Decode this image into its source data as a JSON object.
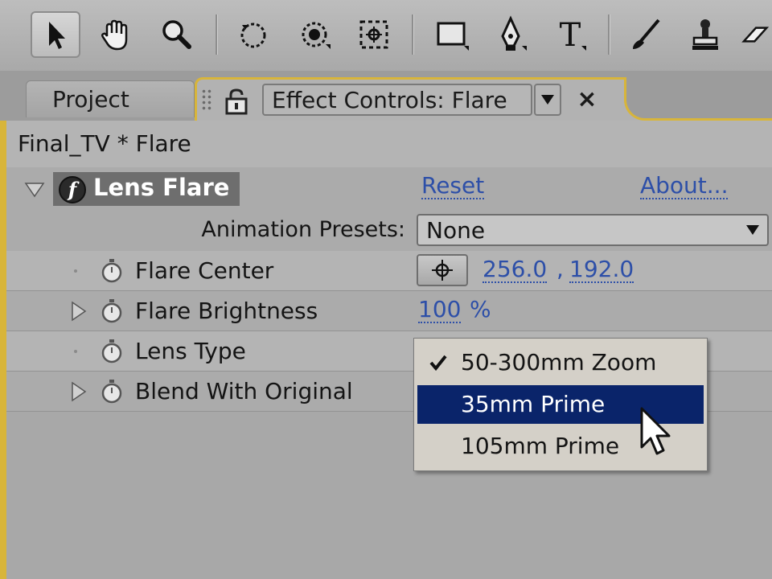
{
  "toolbar": {
    "tools": [
      {
        "name": "selection-tool",
        "icon": "arrow-pointer-icon",
        "active": true
      },
      {
        "name": "hand-tool",
        "icon": "hand-icon",
        "active": false
      },
      {
        "name": "zoom-tool",
        "icon": "magnifier-icon",
        "active": false
      },
      {
        "name": "rotate-tool",
        "icon": "rotate-icon",
        "active": false
      },
      {
        "name": "camera-tool",
        "icon": "orbit-camera-icon",
        "active": false
      },
      {
        "name": "pan-behind-tool",
        "icon": "pan-behind-icon",
        "active": false
      },
      {
        "name": "rectangle-tool",
        "icon": "rectangle-icon",
        "active": false
      },
      {
        "name": "pen-tool",
        "icon": "pen-icon",
        "active": false
      },
      {
        "name": "type-tool",
        "icon": "type-icon",
        "active": false
      },
      {
        "name": "brush-tool",
        "icon": "brush-icon",
        "active": false
      },
      {
        "name": "clone-stamp-tool",
        "icon": "stamp-icon",
        "active": false
      },
      {
        "name": "eraser-tool",
        "icon": "eraser-icon",
        "active": false
      }
    ]
  },
  "tabs": {
    "project_label": "Project",
    "effect_controls_label": "Effect Controls: Flare",
    "close_glyph": "×"
  },
  "panel": {
    "path": "Final_TV * Flare",
    "effect": {
      "name": "Lens Flare",
      "reset_label": "Reset",
      "about_label": "About...",
      "presets_label": "Animation Presets:",
      "presets_value": "None"
    },
    "properties": [
      {
        "label": "Flare Center",
        "value_x": "256.0",
        "value_sep": ",",
        "value_y": "192.0"
      },
      {
        "label": "Flare Brightness",
        "value": "100",
        "unit": "%"
      },
      {
        "label": "Lens Type"
      },
      {
        "label": "Blend With Original"
      }
    ]
  },
  "menu": {
    "items": [
      {
        "label": "50-300mm Zoom",
        "checked": true,
        "highlighted": false
      },
      {
        "label": "35mm Prime",
        "checked": false,
        "highlighted": true
      },
      {
        "label": "105mm Prime",
        "checked": false,
        "highlighted": false
      }
    ]
  },
  "colors": {
    "panel_focus_border": "#d8b53a",
    "link_blue": "#2d4fa8",
    "menu_highlight": "#0a246a"
  }
}
